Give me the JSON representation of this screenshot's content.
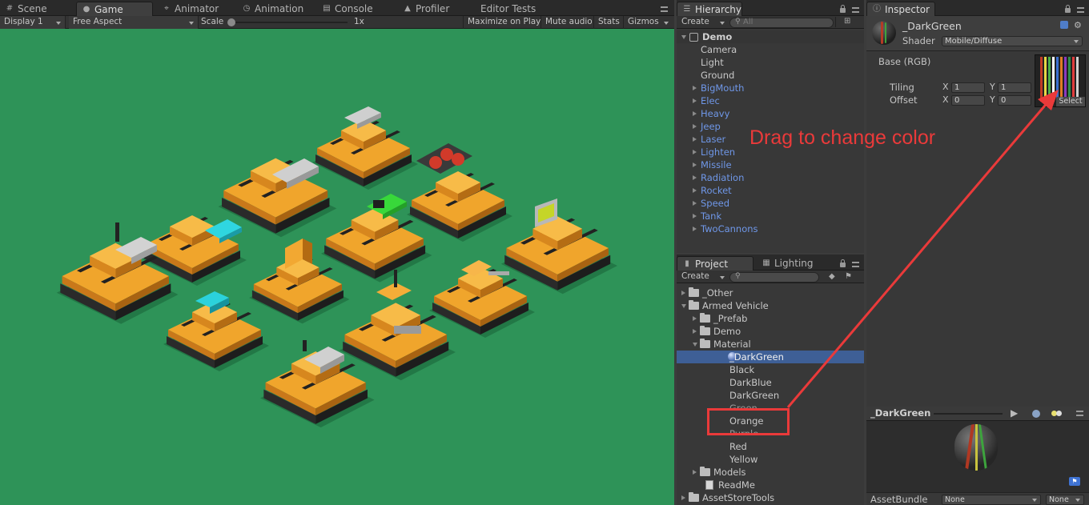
{
  "scene_tabs": {
    "scene": "Scene",
    "game": "Game",
    "animator": "Animator",
    "animation": "Animation",
    "console": "Console",
    "profiler": "Profiler",
    "editor_tests": "Editor Tests"
  },
  "game_toolbar": {
    "display": "Display 1",
    "aspect": "Free Aspect",
    "scale_label": "Scale",
    "scale_value": "1x",
    "maximize": "Maximize on Play",
    "mute": "Mute audio",
    "stats": "Stats",
    "gizmos": "Gizmos"
  },
  "hierarchy": {
    "tab": "Hierarchy",
    "create": "Create",
    "search_placeholder": "All",
    "scene": "Demo",
    "items": [
      {
        "label": "Camera",
        "prefab": false
      },
      {
        "label": "Light",
        "prefab": false
      },
      {
        "label": "Ground",
        "prefab": false
      },
      {
        "label": "BigMouth",
        "prefab": true
      },
      {
        "label": "Elec",
        "prefab": true
      },
      {
        "label": "Heavy",
        "prefab": true
      },
      {
        "label": "Jeep",
        "prefab": true
      },
      {
        "label": "Laser",
        "prefab": true
      },
      {
        "label": "Lighten",
        "prefab": true
      },
      {
        "label": "Missile",
        "prefab": true
      },
      {
        "label": "Radiation",
        "prefab": true
      },
      {
        "label": "Rocket",
        "prefab": true
      },
      {
        "label": "Speed",
        "prefab": true
      },
      {
        "label": "Tank",
        "prefab": true
      },
      {
        "label": "TwoCannons",
        "prefab": true
      }
    ]
  },
  "project": {
    "tab": "Project",
    "lighting_tab": "Lighting",
    "create": "Create",
    "tree": [
      {
        "label": "_Other",
        "depth": 0,
        "kind": "folder",
        "state": "collapsed"
      },
      {
        "label": "Armed Vehicle",
        "depth": 0,
        "kind": "folder",
        "state": "expanded"
      },
      {
        "label": "_Prefab",
        "depth": 1,
        "kind": "folder",
        "state": "collapsed"
      },
      {
        "label": "Demo",
        "depth": 1,
        "kind": "folder",
        "state": "collapsed"
      },
      {
        "label": "Material",
        "depth": 1,
        "kind": "folder",
        "state": "expanded"
      },
      {
        "label": "_DarkGreen",
        "depth": 2,
        "kind": "material",
        "state": "selected"
      },
      {
        "label": "Black",
        "depth": 2,
        "kind": "item",
        "state": ""
      },
      {
        "label": "DarkBlue",
        "depth": 2,
        "kind": "item",
        "state": ""
      },
      {
        "label": "DarkGreen",
        "depth": 2,
        "kind": "item",
        "state": ""
      },
      {
        "label": "Green",
        "depth": 2,
        "kind": "item",
        "state": "dim"
      },
      {
        "label": "Orange",
        "depth": 2,
        "kind": "item",
        "state": "highlighted"
      },
      {
        "label": "Purple",
        "depth": 2,
        "kind": "item",
        "state": "dim"
      },
      {
        "label": "Red",
        "depth": 2,
        "kind": "item",
        "state": ""
      },
      {
        "label": "Yellow",
        "depth": 2,
        "kind": "item",
        "state": ""
      },
      {
        "label": "Models",
        "depth": 1,
        "kind": "folder",
        "state": "collapsed"
      },
      {
        "label": "ReadMe",
        "depth": 1,
        "kind": "doc",
        "state": ""
      },
      {
        "label": "AssetStoreTools",
        "depth": 0,
        "kind": "folder",
        "state": "collapsed"
      }
    ]
  },
  "inspector": {
    "tab": "Inspector",
    "material_name": "_DarkGreen",
    "shader_label": "Shader",
    "shader_value": "Mobile/Diffuse",
    "base_label": "Base (RGB)",
    "tiling_label": "Tiling",
    "offset_label": "Offset",
    "tiling_x": "1",
    "tiling_y": "1",
    "offset_x": "0",
    "offset_y": "0",
    "x_label": "X",
    "y_label": "Y",
    "select_button": "Select"
  },
  "preview": {
    "title": "_DarkGreen",
    "assetbundle_label": "AssetBundle",
    "bundle_name": "None",
    "bundle_variant": "None"
  },
  "annotation": {
    "text": "Drag to change color",
    "color": "#ea3a3a"
  },
  "colors": {
    "game_bg": "#2e9358",
    "vehicle_orange": "#e89a26",
    "prefab_blue": "#6f97e8",
    "selection": "#3e5f96"
  }
}
